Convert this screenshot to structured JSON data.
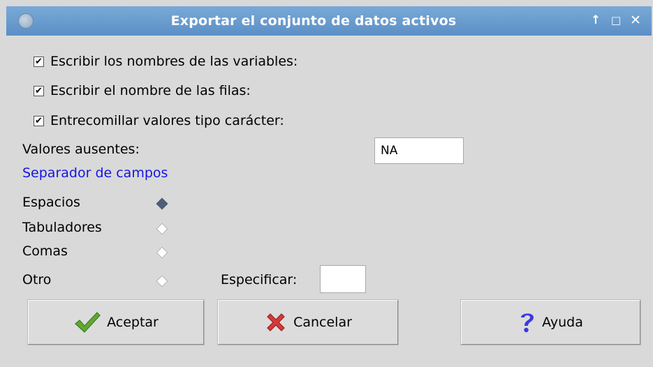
{
  "window": {
    "title": "Exportar el conjunto de datos activos",
    "controls": {
      "up": "↑",
      "maximize": "□",
      "close": "✕"
    }
  },
  "options": [
    {
      "label": "Escribir los nombres de las variables:",
      "checked": true
    },
    {
      "label": "Escribir el nombre de las filas:",
      "checked": true
    },
    {
      "label": "Entrecomillar valores tipo carácter:",
      "checked": true
    }
  ],
  "missing": {
    "label": "Valores ausentes:",
    "value": "NA"
  },
  "separator": {
    "title": "Separador de campos",
    "options": [
      {
        "label": "Espacios",
        "selected": true
      },
      {
        "label": "Tabuladores",
        "selected": false
      },
      {
        "label": "Comas",
        "selected": false
      },
      {
        "label": "Otro",
        "selected": false
      }
    ],
    "specify_label": "Especificar:",
    "specify_value": ""
  },
  "buttons": {
    "ok": {
      "label": "Aceptar",
      "icon": "checkmark-icon"
    },
    "cancel": {
      "label": "Cancelar",
      "icon": "red-x-icon"
    },
    "help": {
      "label": "Ayuda",
      "icon": "question-mark-icon"
    }
  },
  "colors": {
    "titlebar": "#6a9ccf",
    "section_title": "#1414e6",
    "radio_selected": "#4d5d75",
    "ok_icon": "#5fa832",
    "cancel_icon": "#d43a3a",
    "help_icon": "#3a3ae0"
  }
}
